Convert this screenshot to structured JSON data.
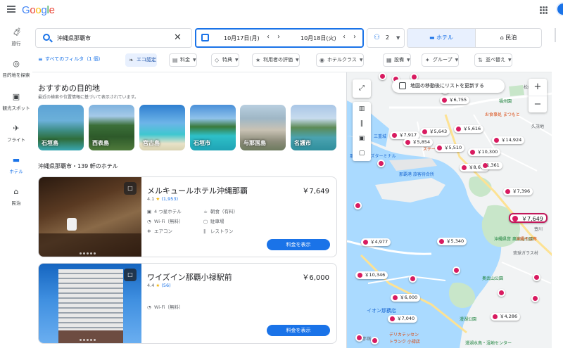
{
  "header": {
    "logo": "Google",
    "icons": {
      "menu": "menu-icon",
      "apps": "apps-grid-icon",
      "account": "avatar"
    }
  },
  "leftnav": {
    "items": [
      {
        "label": "旅行",
        "icon": "luggage-icon"
      },
      {
        "label": "目的地を探索",
        "icon": "explore-icon"
      },
      {
        "label": "観光スポット",
        "icon": "camera-icon"
      },
      {
        "label": "フライト",
        "icon": "airplane-icon"
      },
      {
        "label": "ホテル",
        "icon": "bed-icon",
        "active": true
      },
      {
        "label": "民泊",
        "icon": "house-icon"
      }
    ]
  },
  "search": {
    "value": "沖縄県那覇市"
  },
  "dates": {
    "checkin": "10月17日(月)",
    "checkout": "10月18日(火)"
  },
  "guests": {
    "count": "2"
  },
  "type_tabs": {
    "hotel": "ホテル",
    "minpaku": "民泊",
    "selected": "hotel"
  },
  "filters": {
    "all": "すべてのフィルタ（1 個）",
    "chips": [
      "エコ認定",
      "料金",
      "特典",
      "利用者の評価",
      "ホテルクラス",
      "設備",
      "グループ",
      "並べ替え"
    ]
  },
  "recommend": {
    "title": "おすすめの目的地",
    "subtitle": "最近の検索や位置情報に基づいて表示されています。",
    "destinations": [
      "石垣島",
      "西表島",
      "宮古島",
      "石垣市",
      "与那国島",
      "名護市"
    ]
  },
  "list": {
    "heading": "沖縄県那覇市・139 軒のホテル",
    "view_button": "料金を表示"
  },
  "hotels": [
    {
      "name": "メルキュールホテル沖縄那覇",
      "price": "￥7,649",
      "rating": "4.1",
      "reviews": "(1,953)",
      "amenities": [
        "4 つ星ホテル",
        "朝食（有料）",
        "Wi-Fi（無料）",
        "駐車場",
        "エアコン",
        "レストラン"
      ]
    },
    {
      "name": "ワイズイン那覇小禄駅前",
      "price": "￥6,000",
      "rating": "4.4",
      "reviews": "(56)",
      "amenities": [
        "Wi-Fi（無料）"
      ]
    }
  ],
  "map": {
    "update_label": "地図の移動後にリストを更新する",
    "pins": [
      "￥6,755",
      "￥7,917",
      "￥5,643",
      "￥5,616",
      "￥5,854",
      "￥14,924",
      "￥5,510",
      "￥10,300",
      "￥8,677",
      "11,361",
      "￥7,396",
      "￥7,649",
      "￥4,977",
      "￥5,340",
      "￥10,346",
      "￥6,000",
      "￥7,040",
      "￥4,286"
    ],
    "labels": [
      "福州園",
      "お食事処 まつもと",
      "久茂地",
      "三重城",
      "ステー",
      "那覇クルーズターミナル",
      "那覇港 旅客待合所",
      "沖縄県営 奥武山公園",
      "琉球ガラス村",
      "奥武山公園",
      "壺川",
      "沖縄そば専",
      "イオン那覇店",
      "漫湖公園",
      "デリカテッセン",
      "トランク 小禄店",
      "赤嶺",
      "漫湖水鳥・湿地センター",
      "松山"
    ],
    "colors": {
      "water": "#aadaff",
      "land": "#f1f3f4",
      "park": "#c8e6c9",
      "pin": "#d81b60"
    }
  }
}
